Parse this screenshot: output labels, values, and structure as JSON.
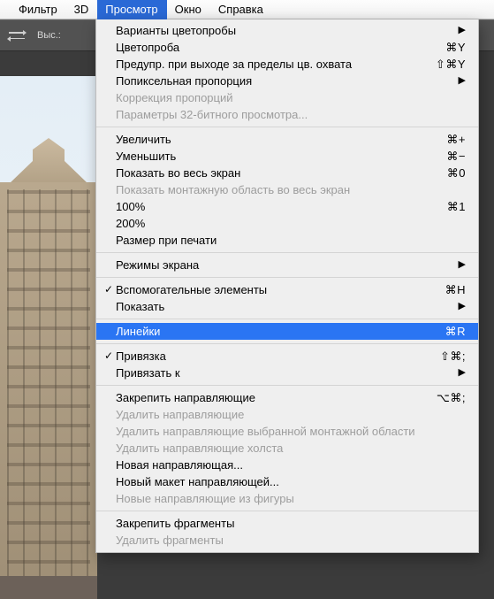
{
  "menubar": {
    "items": [
      {
        "label": "Фильтр"
      },
      {
        "label": "3D"
      },
      {
        "label": "Просмотр"
      },
      {
        "label": "Окно"
      },
      {
        "label": "Справка"
      }
    ],
    "active_index": 2
  },
  "toolbar": {
    "height_label": "Выс.:"
  },
  "dropdown": {
    "items": [
      {
        "type": "item",
        "label": "Варианты цветопробы",
        "submenu": true
      },
      {
        "type": "item",
        "label": "Цветопроба",
        "shortcut": "⌘Y"
      },
      {
        "type": "item",
        "label": "Предупр. при выходе за пределы цв. охвата",
        "shortcut": "⇧⌘Y"
      },
      {
        "type": "item",
        "label": "Попиксельная пропорция",
        "submenu": true
      },
      {
        "type": "item",
        "label": "Коррекция пропорций",
        "disabled": true
      },
      {
        "type": "item",
        "label": "Параметры 32-битного просмотра...",
        "disabled": true
      },
      {
        "type": "sep"
      },
      {
        "type": "item",
        "label": "Увеличить",
        "shortcut": "⌘+"
      },
      {
        "type": "item",
        "label": "Уменьшить",
        "shortcut": "⌘−"
      },
      {
        "type": "item",
        "label": "Показать во весь экран",
        "shortcut": "⌘0"
      },
      {
        "type": "item",
        "label": "Показать монтажную область во весь экран",
        "disabled": true
      },
      {
        "type": "item",
        "label": "100%",
        "shortcut": "⌘1"
      },
      {
        "type": "item",
        "label": "200%"
      },
      {
        "type": "item",
        "label": "Размер при печати"
      },
      {
        "type": "sep"
      },
      {
        "type": "item",
        "label": "Режимы экрана",
        "submenu": true
      },
      {
        "type": "sep"
      },
      {
        "type": "item",
        "label": "Вспомогательные элементы",
        "checked": true,
        "shortcut": "⌘H"
      },
      {
        "type": "item",
        "label": "Показать",
        "submenu": true
      },
      {
        "type": "sep"
      },
      {
        "type": "item",
        "label": "Линейки",
        "shortcut": "⌘R",
        "highlight": true
      },
      {
        "type": "sep"
      },
      {
        "type": "item",
        "label": "Привязка",
        "checked": true,
        "shortcut": "⇧⌘;"
      },
      {
        "type": "item",
        "label": "Привязать к",
        "submenu": true
      },
      {
        "type": "sep"
      },
      {
        "type": "item",
        "label": "Закрепить направляющие",
        "shortcut": "⌥⌘;"
      },
      {
        "type": "item",
        "label": "Удалить направляющие",
        "disabled": true
      },
      {
        "type": "item",
        "label": "Удалить направляющие выбранной монтажной области",
        "disabled": true
      },
      {
        "type": "item",
        "label": "Удалить направляющие холста",
        "disabled": true
      },
      {
        "type": "item",
        "label": "Новая направляющая..."
      },
      {
        "type": "item",
        "label": "Новый макет направляющей..."
      },
      {
        "type": "item",
        "label": "Новые направляющие из фигуры",
        "disabled": true
      },
      {
        "type": "sep"
      },
      {
        "type": "item",
        "label": "Закрепить фрагменты"
      },
      {
        "type": "item",
        "label": "Удалить фрагменты",
        "disabled": true
      }
    ]
  }
}
